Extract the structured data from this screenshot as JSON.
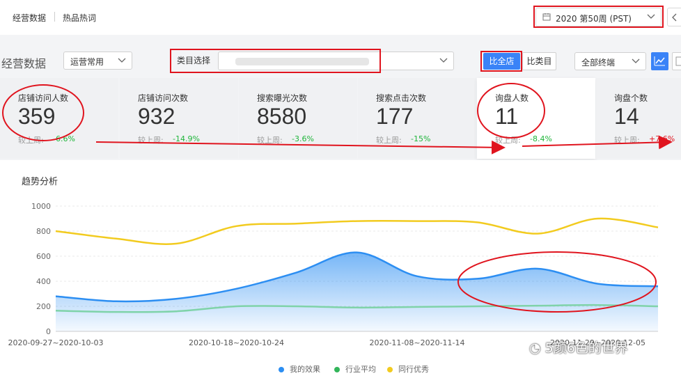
{
  "topbar": {
    "tabs": [
      "经营数据",
      "热品热词"
    ],
    "week_label": "2020 第50周 (PST)"
  },
  "filters": {
    "page_title": "经营数据",
    "preset_select": "运营常用",
    "category_label": "类目选择",
    "compare_all_label": "比全店",
    "compare_category_label": "比类目",
    "terminal_select": "全部终端"
  },
  "metrics": [
    {
      "label": "店铺访问人数",
      "value": "359",
      "compare_label": "较上周:",
      "change": "-6.6%",
      "direction": "down"
    },
    {
      "label": "店铺访问次数",
      "value": "932",
      "compare_label": "较上周:",
      "change": "-14.9%",
      "direction": "down"
    },
    {
      "label": "搜索曝光次数",
      "value": "8580",
      "compare_label": "较上周:",
      "change": "-3.6%",
      "direction": "down"
    },
    {
      "label": "搜索点击次数",
      "value": "177",
      "compare_label": "较上周:",
      "change": "-15%",
      "direction": "down"
    },
    {
      "label": "询盘人数",
      "value": "11",
      "compare_label": "较上周:",
      "change": "-8.4%",
      "direction": "down"
    },
    {
      "label": "询盘个数",
      "value": "14",
      "compare_label": "较上周:",
      "change": "+7.6%",
      "direction": "up"
    }
  ],
  "chart_title": "趋势分析",
  "watermark": "5颜6色的世界",
  "colors": {
    "primary": "#3a83f7",
    "mine": "#2c8ef2",
    "industry_avg": "#7fd3a9",
    "peer_best": "#f2cb1f",
    "annotation_red": "#e0141e",
    "down": "#1fb53a",
    "up": "#e0141e"
  },
  "chart_data": {
    "type": "area",
    "title": "趋势分析",
    "ylim": [
      0,
      1000
    ],
    "yticks": [
      0,
      200,
      400,
      600,
      800,
      1000
    ],
    "x_tick_labels": [
      {
        "index": 0,
        "label": "2020-09-27~2020-10-03"
      },
      {
        "index": 3,
        "label": "2020-10-18~2020-10-24"
      },
      {
        "index": 6,
        "label": "2020-11-08~2020-11-14"
      },
      {
        "index": 9,
        "label": "2020-11-29~2020-12-05"
      }
    ],
    "point_count": 11,
    "grid": true,
    "legend_position": "bottom",
    "series": [
      {
        "name": "我的效果",
        "values": [
          280,
          240,
          260,
          340,
          470,
          630,
          440,
          420,
          500,
          380,
          360
        ],
        "fill": true
      },
      {
        "name": "行业平均",
        "values": [
          165,
          155,
          160,
          200,
          200,
          190,
          195,
          200,
          205,
          210,
          200
        ]
      },
      {
        "name": "同行优秀",
        "values": [
          800,
          740,
          700,
          840,
          860,
          880,
          880,
          870,
          780,
          900,
          830
        ]
      }
    ]
  }
}
